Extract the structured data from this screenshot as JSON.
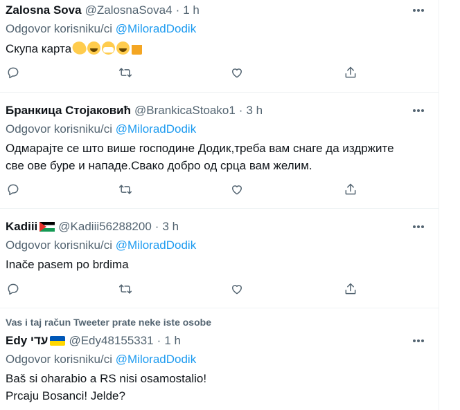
{
  "tweets": [
    {
      "name": "Zalosna Sova",
      "handle": "@ZalosnaSova4",
      "dot": "·",
      "time": "1 h",
      "reply_prefix": "Odgovor korisniku/ci",
      "mention": "@MiloradDodik",
      "lines": [
        "Скупа карта"
      ],
      "emojis": [
        "clapping-hands",
        "rolling-laughing",
        "face-with-mask",
        "grinning",
        "beer-mug"
      ]
    },
    {
      "name": "Бранкица Стојаковић",
      "handle": "@BrankicaStoako1",
      "dot": "·",
      "time": "3 h",
      "reply_prefix": "Odgovor korisniku/ci",
      "mention": "@MiloradDodik",
      "lines": [
        "Одмарајте се што више господине Додик,треба вам снаге да издржите",
        "све ове буре и нападе.Свако добро од срца вам желим."
      ]
    },
    {
      "name": "Kadiii",
      "handle": "@Kadiii56288200",
      "dot": "·",
      "time": "3 h",
      "reply_prefix": "Odgovor korisniku/ci",
      "mention": "@MiloradDodik",
      "lines": [
        "Inače pasem po brdima"
      ],
      "flag": "palestine-flag"
    },
    {
      "name": "Edy עדי",
      "handle": "@Edy48155331",
      "dot": "·",
      "time": "1 h",
      "reply_prefix": "Odgovor korisniku/ci",
      "mention": "@MiloradDodik",
      "lines": [
        "Baš si oharabio a RS nisi osamostalio!",
        "Prcaju Bosanci! Jelde?"
      ],
      "flag": "ukraine-flag"
    }
  ],
  "section_label": "Vas i taj račun Tweeter prate neke iste osobe",
  "icons": {
    "more": "more-horizontal-icon",
    "reply": "reply-bubble-icon",
    "retweet": "retweet-icon",
    "like": "heart-icon",
    "share": "share-icon"
  },
  "colors": {
    "text": "#0f1419",
    "muted": "#536471",
    "accent": "#1d9bf0",
    "divider": "#eff3f4"
  }
}
